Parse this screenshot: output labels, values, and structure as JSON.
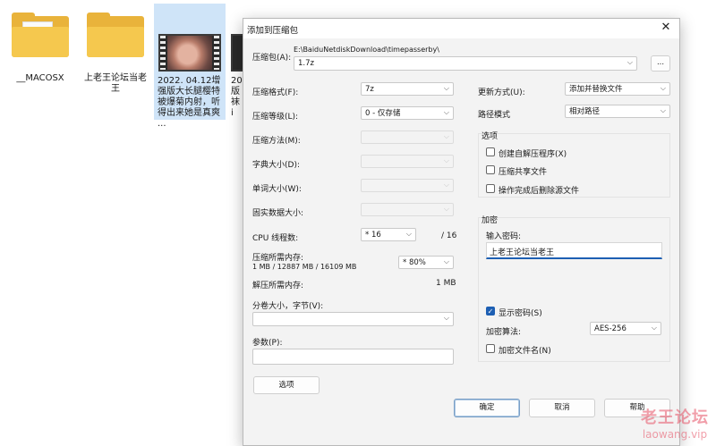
{
  "desktop": {
    "items": [
      {
        "label": "__MACOSX"
      },
      {
        "label": "上老王论坛当老王"
      },
      {
        "label": "2022. 04.12增强版大长腿樱特被爆菊内射，听得出来她是真爽 ..."
      },
      {
        "label": "20 版 袜 i"
      }
    ]
  },
  "dialog": {
    "title": "添加到压缩包",
    "close": "✕",
    "archive": {
      "label": "压缩包(A):",
      "path": "E:\\BaiduNetdiskDownload\\timepasserby\\",
      "value": "1.7z",
      "browse": "..."
    },
    "left": {
      "format": {
        "label": "压缩格式(F):",
        "value": "7z"
      },
      "level": {
        "label": "压缩等级(L):",
        "value": "0 - 仅存储"
      },
      "method": {
        "label": "压缩方法(M):"
      },
      "dict": {
        "label": "字典大小(D):"
      },
      "word": {
        "label": "单词大小(W):"
      },
      "solid": {
        "label": "固实数据大小:"
      },
      "cpu": {
        "label": "CPU 线程数:",
        "value": "* 16",
        "max": "/ 16"
      },
      "mem": {
        "label": "压缩所需内存:",
        "detail": "1 MB / 12887 MB / 16109 MB",
        "value": "* 80%"
      },
      "decomp": {
        "label": "解压所需内存:",
        "value": "1 MB"
      },
      "split": {
        "label": "分卷大小，字节(V):"
      },
      "params": {
        "label": "参数(P):"
      },
      "options_btn": "选项"
    },
    "right": {
      "update": {
        "label": "更新方式(U):",
        "value": "添加并替换文件"
      },
      "pathmode": {
        "label": "路径模式",
        "value": "相对路径"
      },
      "options": {
        "title": "选项",
        "sfx": "创建自解压程序(X)",
        "shared": "压缩共享文件",
        "delete": "操作完成后删除源文件"
      },
      "encrypt": {
        "title": "加密",
        "pw_label": "输入密码:",
        "pw_value": "上老王论坛当老王",
        "show_pw": "显示密码(S)",
        "show_pw_checked": true,
        "method_label": "加密算法:",
        "method_value": "AES-256",
        "enc_names": "加密文件名(N)"
      }
    },
    "buttons": {
      "ok": "确定",
      "cancel": "取消",
      "help": "帮助"
    }
  },
  "watermark": {
    "line1": "老王论坛",
    "line2": "laowang.vip"
  }
}
